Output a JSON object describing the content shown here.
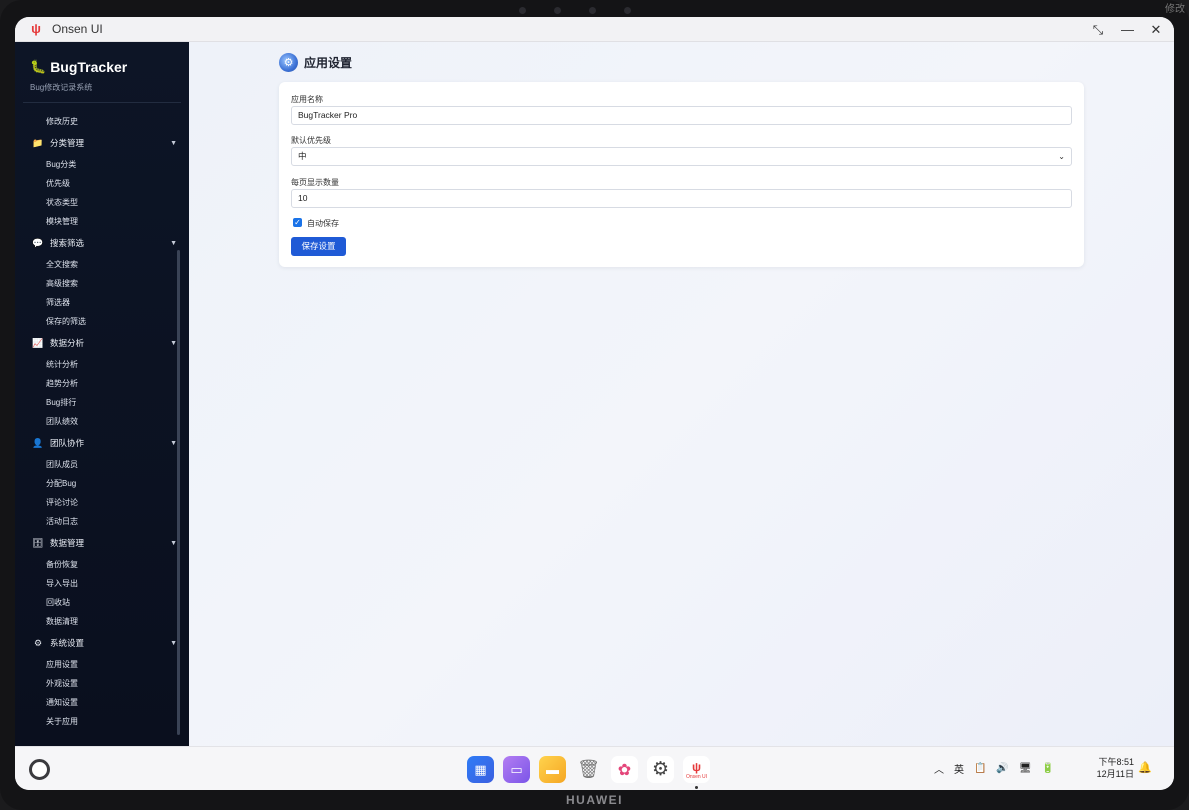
{
  "device": {
    "brand": "HUAWEI",
    "corner_text": "修改"
  },
  "window": {
    "title": "Onsen UI",
    "logo": "ψ"
  },
  "sidebar": {
    "brand_name": "BugTracker",
    "brand_icon": "🐛",
    "subtitle": "Bug修改记录系统",
    "top_items": [
      {
        "label": "修改历史"
      }
    ],
    "sections": [
      {
        "label": "分类管理",
        "icon": "📁",
        "items": [
          "Bug分类",
          "优先级",
          "状态类型",
          "模块管理"
        ]
      },
      {
        "label": "搜索筛选",
        "icon": "💬",
        "items": [
          "全文搜索",
          "高级搜索",
          "筛选器",
          "保存的筛选"
        ]
      },
      {
        "label": "数据分析",
        "icon": "📈",
        "items": [
          "统计分析",
          "趋势分析",
          "Bug排行",
          "团队绩效"
        ]
      },
      {
        "label": "团队协作",
        "icon": "👤",
        "items": [
          "团队成员",
          "分配Bug",
          "评论讨论",
          "活动日志"
        ]
      },
      {
        "label": "数据管理",
        "icon": "🗄",
        "items": [
          "备份恢复",
          "导入导出",
          "回收站",
          "数据清理"
        ]
      },
      {
        "label": "系统设置",
        "icon": "⚙",
        "items": [
          "应用设置",
          "外观设置",
          "通知设置",
          "关于应用"
        ]
      }
    ]
  },
  "page": {
    "title": "应用设置",
    "form": {
      "app_name_label": "应用名称",
      "app_name_value": "BugTracker Pro",
      "priority_label": "默认优先级",
      "priority_value": "中",
      "page_size_label": "每页显示数量",
      "page_size_value": "10",
      "autosave_label": "自动保存",
      "autosave_checked": true,
      "save_button": "保存设置"
    }
  },
  "taskbar": {
    "dock": [
      "app-grid",
      "multi-window",
      "files",
      "trash",
      "photos",
      "settings",
      "onsen-ui"
    ],
    "onsen_label": "Onsen UI",
    "tray_ime": "英",
    "clock_time": "下午8:51",
    "clock_date": "12月11日"
  },
  "colors": {
    "accent": "#1f5ad6",
    "sidebar_bg": "#0d1526",
    "checkbox": "#1a73e8"
  }
}
